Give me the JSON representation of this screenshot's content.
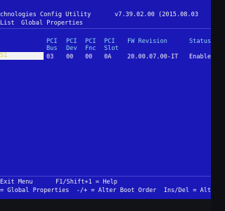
{
  "header": {
    "title": "chnologies Config Utility",
    "version": "v7.39.02.00 (2015.08.03",
    "menu_list": "List",
    "menu_global": "Global Properties"
  },
  "table": {
    "header_row1": [
      "PCI",
      "PCI",
      "PCI",
      "PCI",
      "FW Revision",
      "Status"
    ],
    "header_row2": [
      "Bus",
      "Dev",
      "Fnc",
      "Slot",
      "",
      ""
    ],
    "row": {
      "name": "S1",
      "bus": "03",
      "dev": "00",
      "fnc": "00",
      "slot": "0A",
      "fw": "20.00.07.00-IT",
      "status": "Enable"
    }
  },
  "footer": {
    "line1_left": "Exit Menu",
    "line1_right": "F1/Shift+1 = Help",
    "line2": "= Global Properties  -/+ = Alter Boot Order  Ins/Del = Alte"
  },
  "colors": {
    "background": "#1b18b8",
    "highlight": "#f3f3f3",
    "text": "#f0f0f4",
    "accent": "#ecd33a"
  }
}
